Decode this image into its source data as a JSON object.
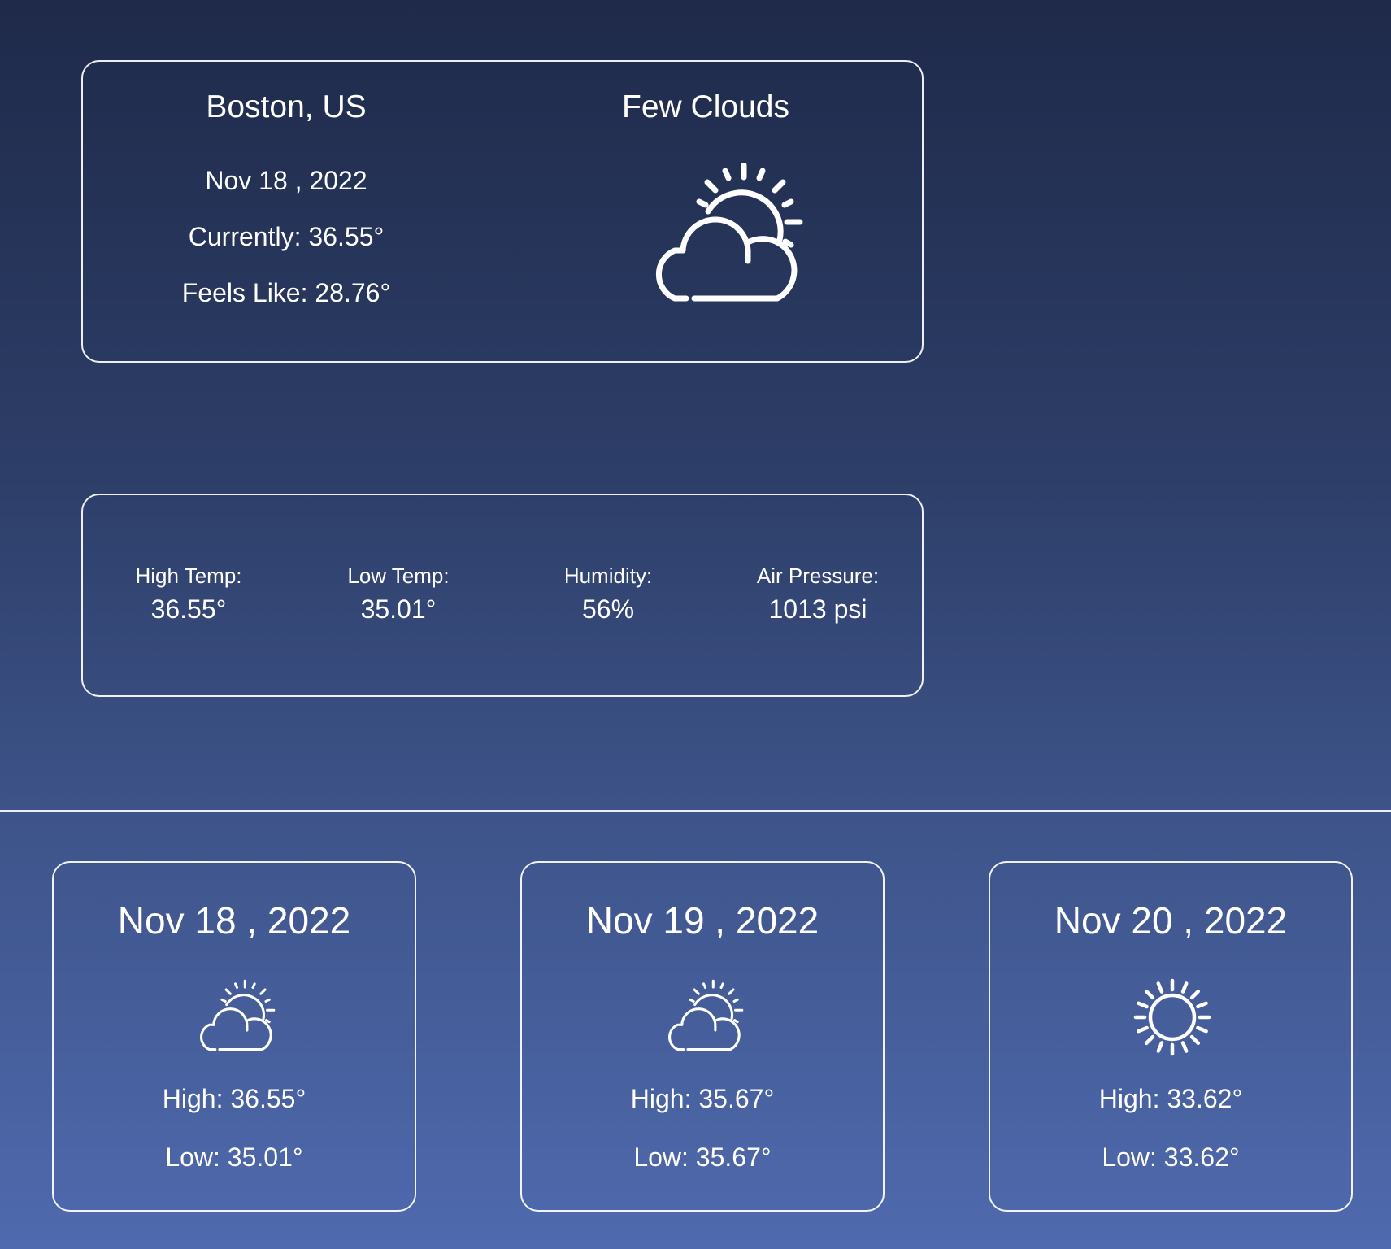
{
  "current": {
    "city": "Boston, US",
    "date": "Nov 18 , 2022",
    "currently": "Currently: 36.55°",
    "feels_like": "Feels Like: 28.76°",
    "condition": "Few Clouds",
    "icon": "partly-cloudy-icon"
  },
  "stats": [
    {
      "label": "High Temp:",
      "value": "36.55°"
    },
    {
      "label": "Low Temp:",
      "value": "35.01°"
    },
    {
      "label": "Humidity:",
      "value": "56%"
    },
    {
      "label": "Air Pressure:",
      "value": "1013 psi"
    }
  ],
  "forecast": [
    {
      "date": "Nov 18 , 2022",
      "icon": "partly-cloudy-icon",
      "high": "High: 36.55°",
      "low": "Low: 35.01°"
    },
    {
      "date": "Nov 19 , 2022",
      "icon": "partly-cloudy-icon",
      "high": "High: 35.67°",
      "low": "Low: 35.67°"
    },
    {
      "date": "Nov 20 , 2022",
      "icon": "sun-icon",
      "high": "High: 33.62°",
      "low": "Low: 33.62°"
    }
  ],
  "colors": {
    "background_top": "#1f2a4a",
    "background_bottom": "#4f6aae",
    "text": "#ffffff",
    "border": "#ffffff"
  }
}
